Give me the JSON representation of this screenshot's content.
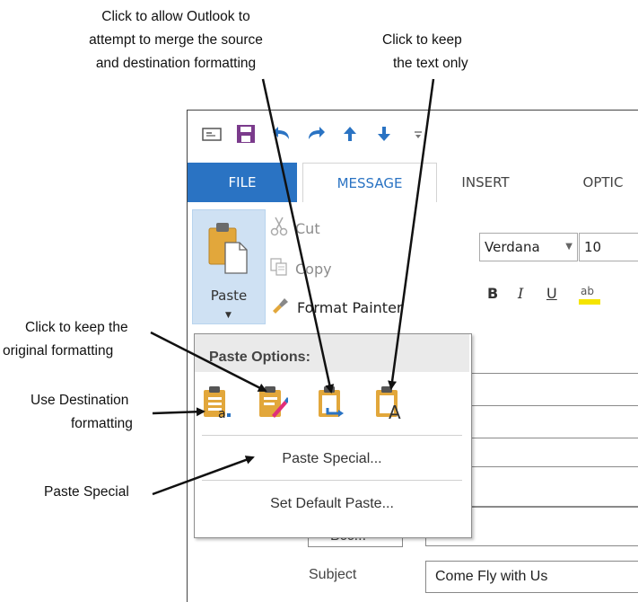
{
  "callouts": {
    "merge": [
      "Click to allow Outlook to",
      "attempt to merge the source",
      "and destination formatting"
    ],
    "keep_text": [
      "Click to keep",
      "the text only"
    ],
    "keep_original": [
      "Click to keep the",
      "original formatting"
    ],
    "use_destination": [
      "Use Destination",
      "formatting"
    ],
    "paste_special": "Paste Special"
  },
  "tabs": {
    "file": "FILE",
    "message": "MESSAGE",
    "insert": "INSERT",
    "options": "OPTIC"
  },
  "clipboard": {
    "paste": "Paste",
    "cut": "Cut",
    "copy": "Copy",
    "format_painter": "Format Painter"
  },
  "font": {
    "name": "Verdana",
    "size": "10"
  },
  "format_buttons": {
    "bold": "B",
    "italic": "I",
    "underline": "U"
  },
  "paste_menu": {
    "header": "Paste Options:",
    "options": [
      "Keep Source Formatting",
      "Merge Formatting",
      "Use Destination Formatting",
      "Keep Text Only"
    ],
    "paste_special": "Paste Special...",
    "set_default": "Set Default Paste..."
  },
  "form": {
    "bcc": "Bcc...",
    "subject_label": "Subject",
    "subject_value": "Come Fly with Us"
  },
  "colors": {
    "accent": "#2a73c3",
    "paste_highlight": "#cfe1f3",
    "qat_purple": "#7b3b8c",
    "clipboard": "#e2a73b"
  },
  "icons": [
    "email-icon",
    "save-icon",
    "undo-icon",
    "redo-icon",
    "up-arrow-icon",
    "down-arrow-icon",
    "customize-qat-icon",
    "paste-icon",
    "cut-icon",
    "copy-icon",
    "format-painter-icon"
  ]
}
